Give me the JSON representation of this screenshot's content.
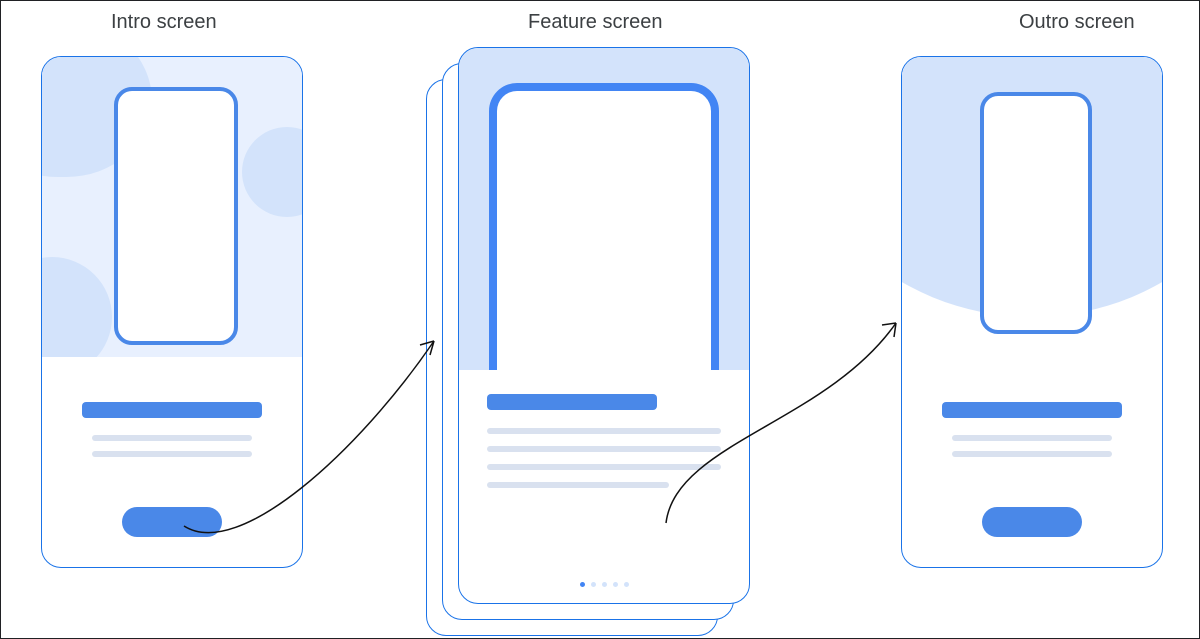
{
  "labels": {
    "intro": "Intro screen",
    "feature": "Feature screen",
    "outro": "Outro screen"
  },
  "feature": {
    "page_dots": 5,
    "active_dot_index": 0
  }
}
